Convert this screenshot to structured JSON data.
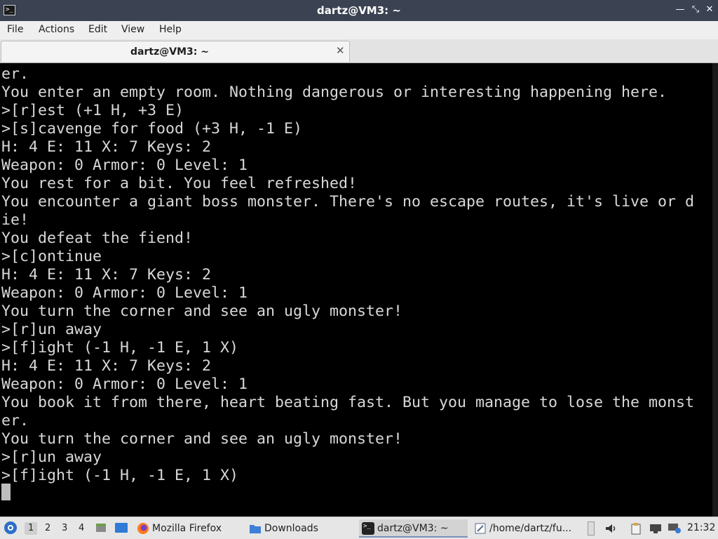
{
  "window": {
    "title": "dartz@VM3: ~",
    "app_icon": "terminal-icon",
    "controls": [
      "minimize-icon",
      "maximize-icon",
      "close-icon"
    ]
  },
  "menubar": {
    "items": [
      "File",
      "Actions",
      "Edit",
      "View",
      "Help"
    ]
  },
  "tabs": [
    {
      "label": "dartz@VM3: ~",
      "close_icon": "close-icon"
    }
  ],
  "terminal": {
    "lines": [
      "er.",
      "You enter an empty room. Nothing dangerous or interesting happening here.",
      ">[r]est (+1 H, +3 E)",
      ">[s]cavenge for food (+3 H, -1 E)",
      "H: 4 E: 11 X: 7 Keys: 2",
      "Weapon: 0 Armor: 0 Level: 1",
      "You rest for a bit. You feel refreshed!",
      "You encounter a giant boss monster. There's no escape routes, it's live or d",
      "ie!",
      "You defeat the fiend!",
      ">[c]ontinue",
      "H: 4 E: 11 X: 7 Keys: 2",
      "Weapon: 0 Armor: 0 Level: 1",
      "You turn the corner and see an ugly monster!",
      ">[r]un away",
      ">[f]ight (-1 H, -1 E, 1 X)",
      "H: 4 E: 11 X: 7 Keys: 2",
      "Weapon: 0 Armor: 0 Level: 1",
      "You book it from there, heart beating fast. But you manage to lose the monst",
      "er.",
      "You turn the corner and see an ugly monster!",
      ">[r]un away",
      ">[f]ight (-1 H, -1 E, 1 X)"
    ]
  },
  "taskbar": {
    "start_icon": "start-menu-icon",
    "workspaces": [
      "1",
      "2",
      "3",
      "4"
    ],
    "active_workspace": "1",
    "quick_launch": [
      "file-manager-icon",
      "show-desktop-icon"
    ],
    "tasks": [
      {
        "label": "Mozilla Firefox",
        "icon": "firefox-icon"
      },
      {
        "label": "Downloads",
        "icon": "folder-icon"
      },
      {
        "label": "dartz@VM3: ~",
        "icon": "terminal-icon"
      },
      {
        "label": "/home/dartz/fu...",
        "icon": "text-editor-icon"
      }
    ],
    "tray": [
      "volume-icon",
      "clipboard-icon",
      "display-icon",
      "network-icon"
    ],
    "clock": "21:32"
  }
}
